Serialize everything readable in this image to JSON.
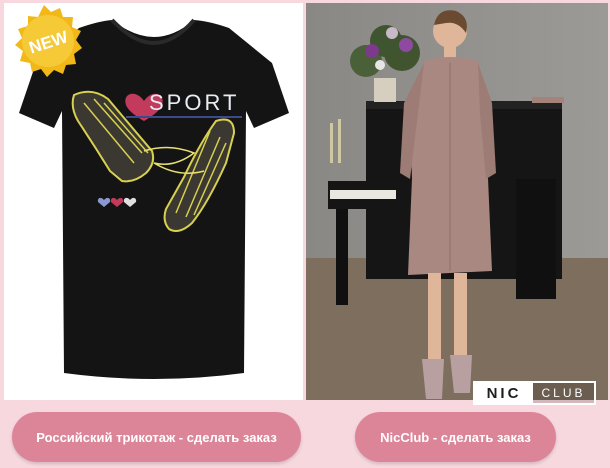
{
  "products": [
    {
      "badge": "NEW",
      "print_text": "SPORT",
      "button_label": "Российский трикотаж - сделать заказ"
    },
    {
      "brand_logo": {
        "part1": "NIC",
        "part2": "CLUB"
      },
      "button_label": "NicClub - сделать заказ"
    }
  ],
  "colors": {
    "background": "#f7d8de",
    "button": "#dd8598",
    "button_text": "#ffffff",
    "tshirt": "#141414",
    "dress": "#a88880",
    "badge": "#f2b818"
  },
  "icons": [
    "new-badge-icon",
    "heart-icon"
  ]
}
